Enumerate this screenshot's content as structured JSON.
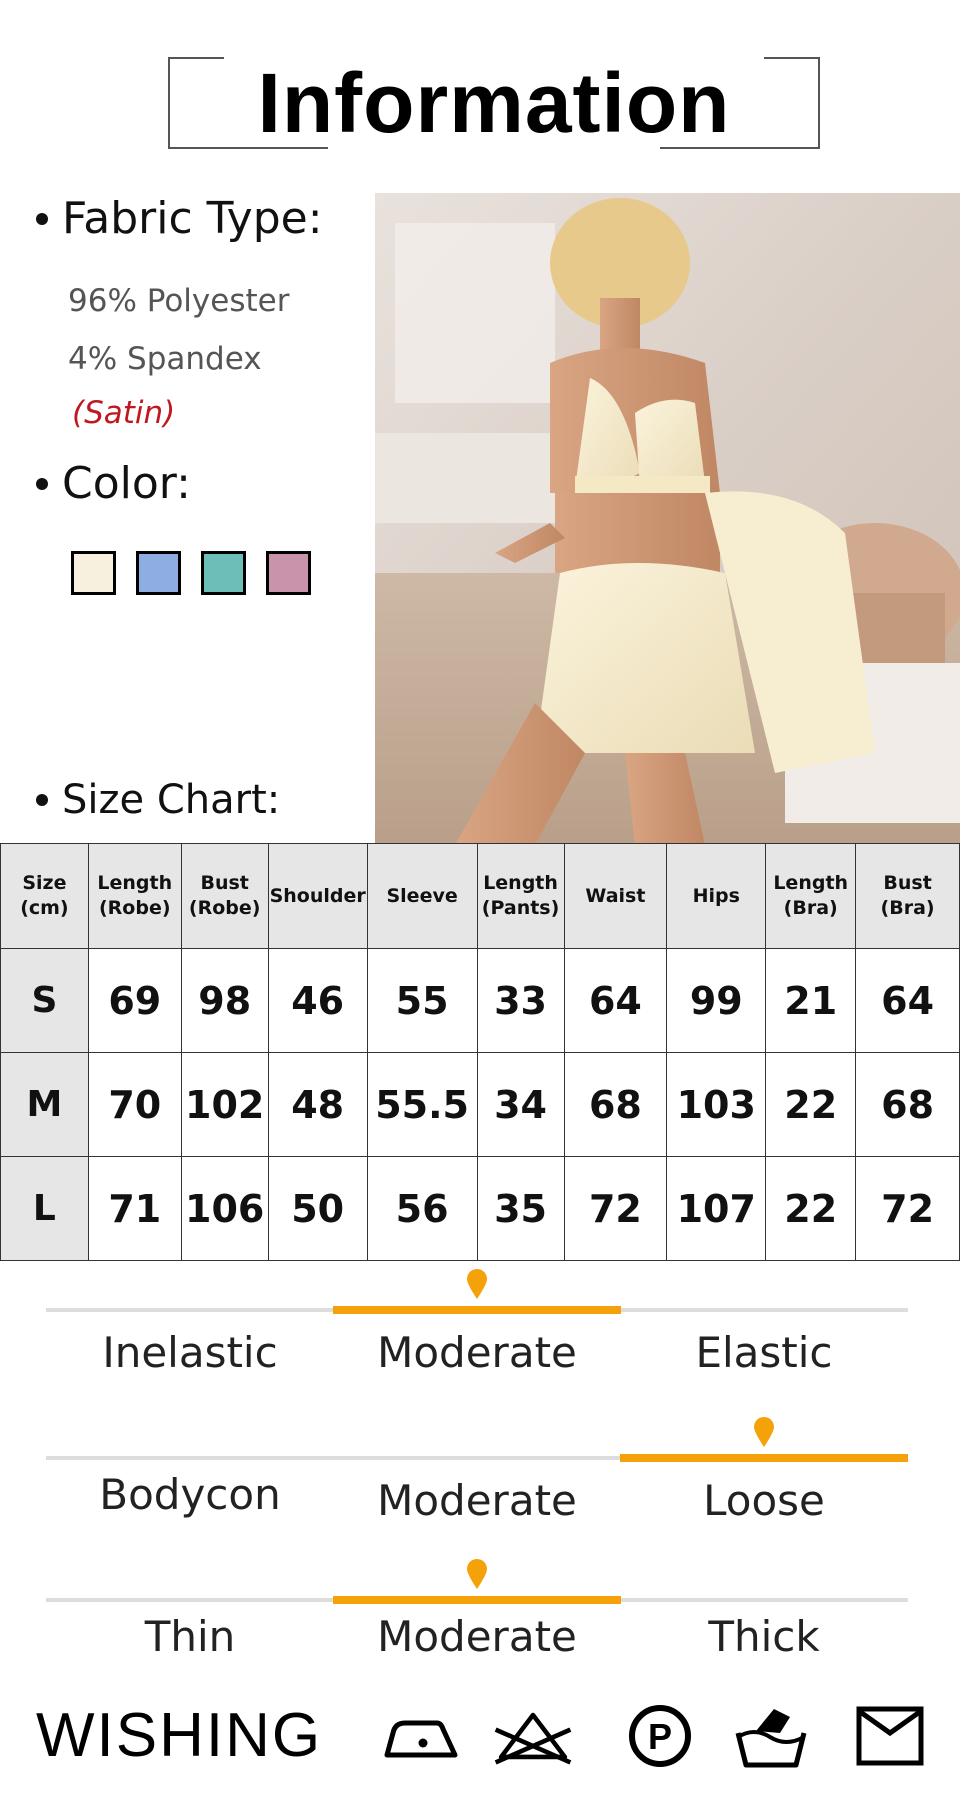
{
  "header": {
    "title": "Information"
  },
  "fabric": {
    "heading": "Fabric Type:",
    "lines": [
      "96% Polyester",
      "4% Spandex"
    ],
    "note": "(Satin)"
  },
  "color": {
    "heading": "Color:",
    "swatches": [
      "#f8f0df",
      "#8eaee2",
      "#6bbfb8",
      "#c893ab"
    ]
  },
  "size_chart": {
    "heading": "Size Chart:",
    "columns": [
      "Size\n(cm)",
      "Length\n(Robe)",
      "Bust\n(Robe)",
      "Shoulder",
      "Sleeve",
      "Length\n(Pants)",
      "Waist",
      "Hips",
      "Length\n(Bra)",
      "Bust\n(Bra)"
    ],
    "rows": [
      [
        "S",
        "69",
        "98",
        "46",
        "55",
        "33",
        "64",
        "99",
        "21",
        "64"
      ],
      [
        "M",
        "70",
        "102",
        "48",
        "55.5",
        "34",
        "68",
        "103",
        "22",
        "68"
      ],
      [
        "L",
        "71",
        "106",
        "50",
        "56",
        "35",
        "72",
        "107",
        "22",
        "72"
      ]
    ]
  },
  "scales": [
    {
      "labels": [
        "Inelastic",
        "Moderate",
        "Elastic"
      ],
      "selected": "Moderate"
    },
    {
      "labels": [
        "Bodycon",
        "Moderate",
        "Loose"
      ],
      "selected": "Loose"
    },
    {
      "labels": [
        "Thin",
        "Moderate",
        "Thick"
      ],
      "selected": "Moderate"
    }
  ],
  "footer": {
    "brand": "WISHING",
    "care_icons": [
      "iron-low-heat-icon",
      "do-not-bleach-icon",
      "dry-clean-p-icon",
      "hand-wash-icon",
      "tumble-dry-flat-icon"
    ]
  },
  "accent_color": "#f5a10a"
}
